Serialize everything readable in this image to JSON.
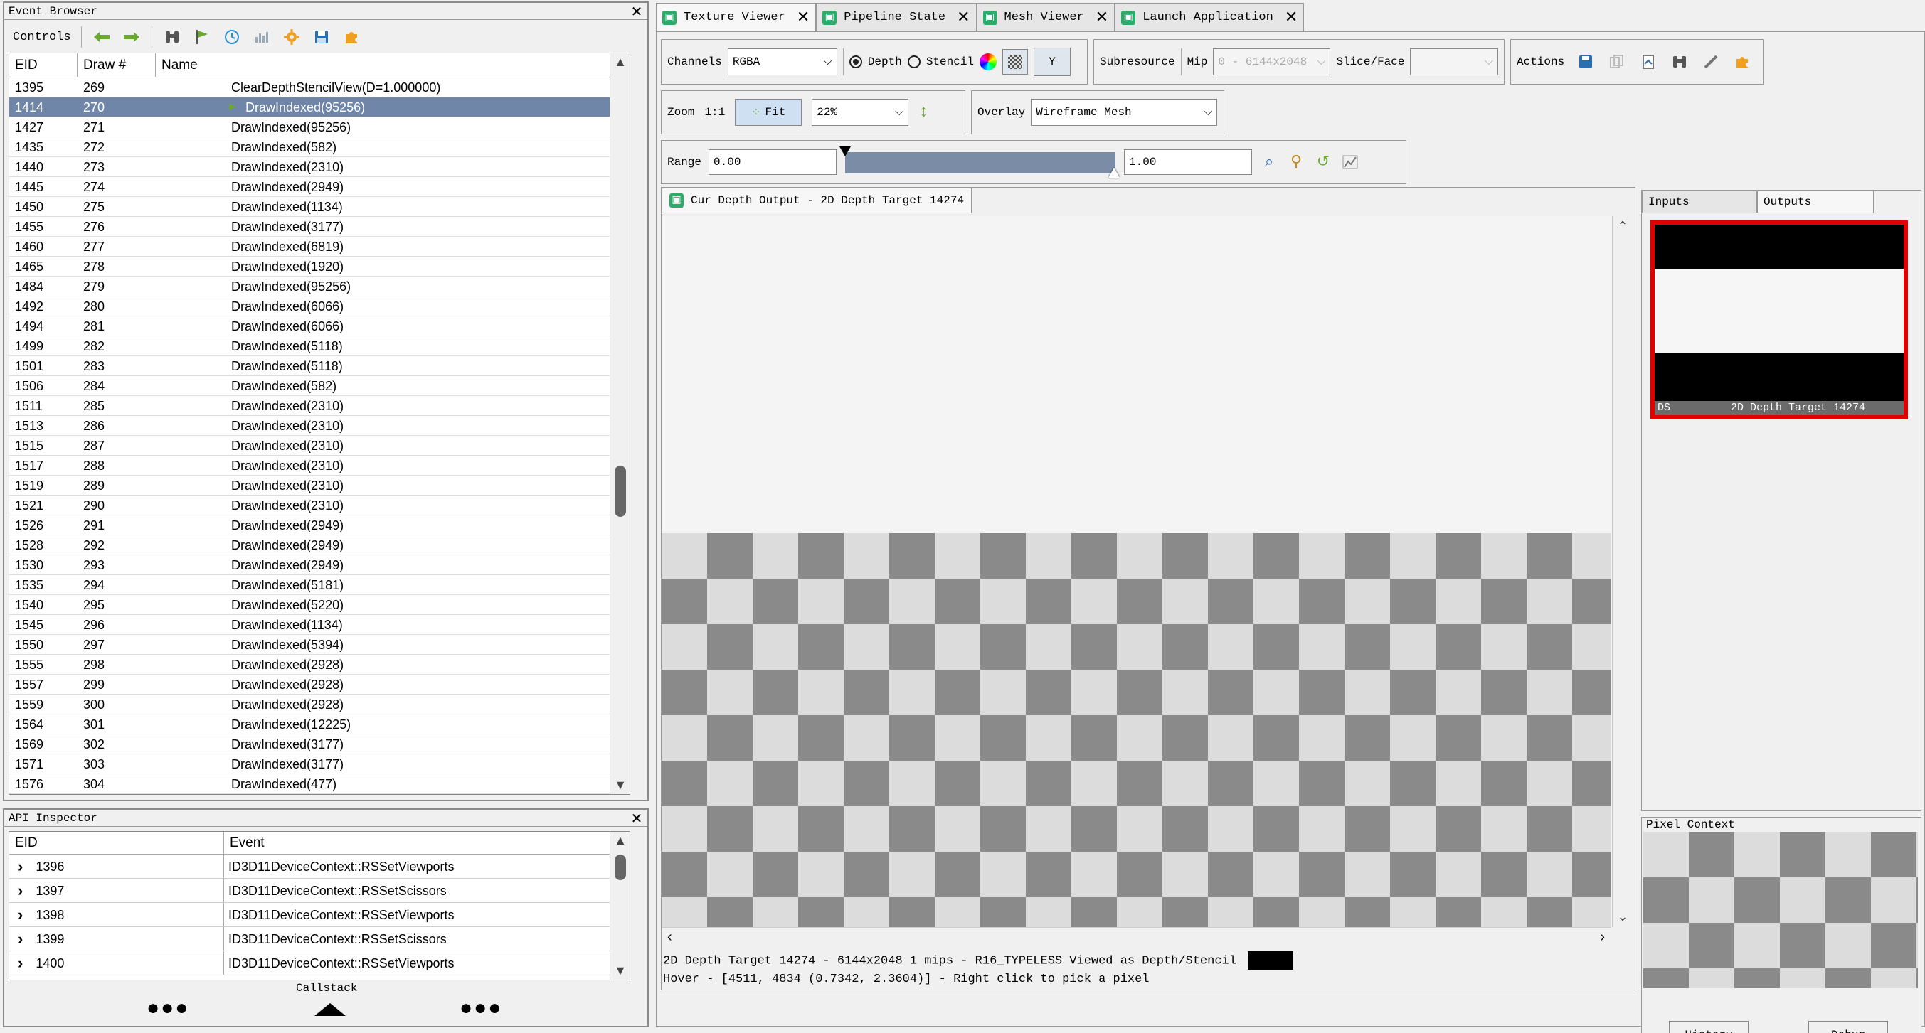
{
  "event_browser": {
    "title": "Event Browser",
    "controls_label": "Controls",
    "columns": [
      "EID",
      "Draw #",
      "Name"
    ],
    "rows": [
      {
        "eid": "1395",
        "draw": "269",
        "name": "ClearDepthStencilView(D=1.000000)"
      },
      {
        "eid": "1414",
        "draw": "270",
        "name": "DrawIndexed(95256)"
      },
      {
        "eid": "1427",
        "draw": "271",
        "name": "DrawIndexed(95256)"
      },
      {
        "eid": "1435",
        "draw": "272",
        "name": "DrawIndexed(582)"
      },
      {
        "eid": "1440",
        "draw": "273",
        "name": "DrawIndexed(2310)"
      },
      {
        "eid": "1445",
        "draw": "274",
        "name": "DrawIndexed(2949)"
      },
      {
        "eid": "1450",
        "draw": "275",
        "name": "DrawIndexed(1134)"
      },
      {
        "eid": "1455",
        "draw": "276",
        "name": "DrawIndexed(3177)"
      },
      {
        "eid": "1460",
        "draw": "277",
        "name": "DrawIndexed(6819)"
      },
      {
        "eid": "1465",
        "draw": "278",
        "name": "DrawIndexed(1920)"
      },
      {
        "eid": "1484",
        "draw": "279",
        "name": "DrawIndexed(95256)"
      },
      {
        "eid": "1492",
        "draw": "280",
        "name": "DrawIndexed(6066)"
      },
      {
        "eid": "1494",
        "draw": "281",
        "name": "DrawIndexed(6066)"
      },
      {
        "eid": "1499",
        "draw": "282",
        "name": "DrawIndexed(5118)"
      },
      {
        "eid": "1501",
        "draw": "283",
        "name": "DrawIndexed(5118)"
      },
      {
        "eid": "1506",
        "draw": "284",
        "name": "DrawIndexed(582)"
      },
      {
        "eid": "1511",
        "draw": "285",
        "name": "DrawIndexed(2310)"
      },
      {
        "eid": "1513",
        "draw": "286",
        "name": "DrawIndexed(2310)"
      },
      {
        "eid": "1515",
        "draw": "287",
        "name": "DrawIndexed(2310)"
      },
      {
        "eid": "1517",
        "draw": "288",
        "name": "DrawIndexed(2310)"
      },
      {
        "eid": "1519",
        "draw": "289",
        "name": "DrawIndexed(2310)"
      },
      {
        "eid": "1521",
        "draw": "290",
        "name": "DrawIndexed(2310)"
      },
      {
        "eid": "1526",
        "draw": "291",
        "name": "DrawIndexed(2949)"
      },
      {
        "eid": "1528",
        "draw": "292",
        "name": "DrawIndexed(2949)"
      },
      {
        "eid": "1530",
        "draw": "293",
        "name": "DrawIndexed(2949)"
      },
      {
        "eid": "1535",
        "draw": "294",
        "name": "DrawIndexed(5181)"
      },
      {
        "eid": "1540",
        "draw": "295",
        "name": "DrawIndexed(5220)"
      },
      {
        "eid": "1545",
        "draw": "296",
        "name": "DrawIndexed(1134)"
      },
      {
        "eid": "1550",
        "draw": "297",
        "name": "DrawIndexed(5394)"
      },
      {
        "eid": "1555",
        "draw": "298",
        "name": "DrawIndexed(2928)"
      },
      {
        "eid": "1557",
        "draw": "299",
        "name": "DrawIndexed(2928)"
      },
      {
        "eid": "1559",
        "draw": "300",
        "name": "DrawIndexed(2928)"
      },
      {
        "eid": "1564",
        "draw": "301",
        "name": "DrawIndexed(12225)"
      },
      {
        "eid": "1569",
        "draw": "302",
        "name": "DrawIndexed(3177)"
      },
      {
        "eid": "1571",
        "draw": "303",
        "name": "DrawIndexed(3177)"
      },
      {
        "eid": "1576",
        "draw": "304",
        "name": "DrawIndexed(477)"
      }
    ],
    "selected_eid": "1414",
    "icons": [
      "back-arrow-icon",
      "forward-arrow-icon",
      "binoculars-icon",
      "flag-icon",
      "clock-icon",
      "timeline-icon",
      "gear-icon",
      "save-icon",
      "puzzle-icon"
    ]
  },
  "api_inspector": {
    "title": "API Inspector",
    "columns": [
      "EID",
      "Event"
    ],
    "rows": [
      {
        "eid": "1396",
        "event": "ID3D11DeviceContext::RSSetViewports"
      },
      {
        "eid": "1397",
        "event": "ID3D11DeviceContext::RSSetScissors"
      },
      {
        "eid": "1398",
        "event": "ID3D11DeviceContext::RSSetViewports"
      },
      {
        "eid": "1399",
        "event": "ID3D11DeviceContext::RSSetScissors"
      },
      {
        "eid": "1400",
        "event": "ID3D11DeviceContext::RSSetViewports"
      }
    ],
    "callstack_label": "Callstack"
  },
  "tabs": [
    {
      "label": "Texture Viewer",
      "active": true
    },
    {
      "label": "Pipeline State",
      "active": false
    },
    {
      "label": "Mesh Viewer",
      "active": false
    },
    {
      "label": "Launch Application",
      "active": false
    }
  ],
  "texture_viewer": {
    "channels_label": "Channels",
    "channels_value": "RGBA",
    "depth_label": "Depth",
    "stencil_label": "Stencil",
    "y_button": "Y",
    "subresource_label": "Subresource",
    "mip_label": "Mip",
    "mip_value": "0 - 6144x2048",
    "slice_label": "Slice/Face",
    "slice_value": "",
    "actions_label": "Actions",
    "zoom_label": "Zoom",
    "zoom_11": "1:1",
    "fit_button": "Fit",
    "zoom_value": "22%",
    "overlay_label": "Overlay",
    "overlay_value": "Wireframe Mesh",
    "range_label": "Range",
    "range_min": "0.00",
    "range_max": "1.00",
    "viewer_tab": "Cur Depth Output - 2D Depth Target 14274",
    "status_line1": "2D Depth Target 14274 - 6144x2048 1 mips - R16_TYPELESS Viewed as Depth/Stencil",
    "status_line2": "Hover - [4511, 4834 (0.7342, 2.3604)] - Right click to pick a pixel"
  },
  "side_panel": {
    "tabs": [
      "Inputs",
      "Outputs"
    ],
    "active_tab": "Outputs",
    "thumb_slot": "DS",
    "thumb_name": "2D Depth Target 14274",
    "thumb_border_color": "#e00000"
  },
  "pixel_context": {
    "title": "Pixel Context",
    "history_button": "History",
    "debug_button": "Debug"
  },
  "colors": {
    "selection": "#6f86a8",
    "tab_icon": "#2eaa6a",
    "toolbar_green": "#6aa830",
    "toolbar_orange": "#f0a020"
  }
}
